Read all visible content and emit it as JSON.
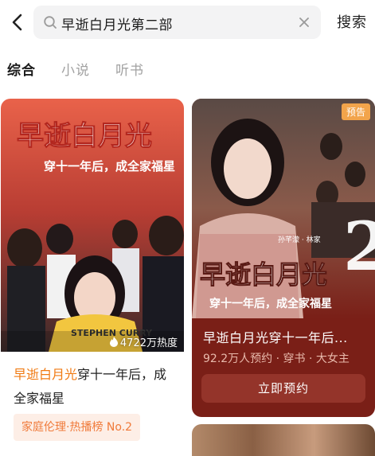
{
  "search": {
    "query": "早逝白月光第二部",
    "action_label": "搜索"
  },
  "tabs": [
    {
      "label": "综合",
      "active": true
    },
    {
      "label": "小说",
      "active": false
    },
    {
      "label": "听书",
      "active": false
    }
  ],
  "cards": [
    {
      "cover_title": "早逝白月光",
      "cover_subtitle": "穿十一年后，成全家福星",
      "shirt_text": "STEPHEN CURRY",
      "heat": "4722万热度",
      "title_highlight": "早逝白月光",
      "title_rest": "穿十一年后，成全家福星",
      "tag": "家庭伦理·热播榜 No.2"
    },
    {
      "badge": "预告",
      "cover_title": "早逝白月光",
      "cover_subtitle": "穿十一年后，成全家福星",
      "cover_number": "2",
      "cast_note": "孙芊濛 · 林家",
      "title": "早逝白月光穿十一年后...",
      "subtitle": "92.2万人预约 · 穿书 · 大女主",
      "button_label": "立即预约"
    }
  ],
  "colors": {
    "accent": "#f07a12",
    "tag_bg": "#fdeee6",
    "right_card_bg": "#7a1f17",
    "reserve_button": "#94342a"
  }
}
